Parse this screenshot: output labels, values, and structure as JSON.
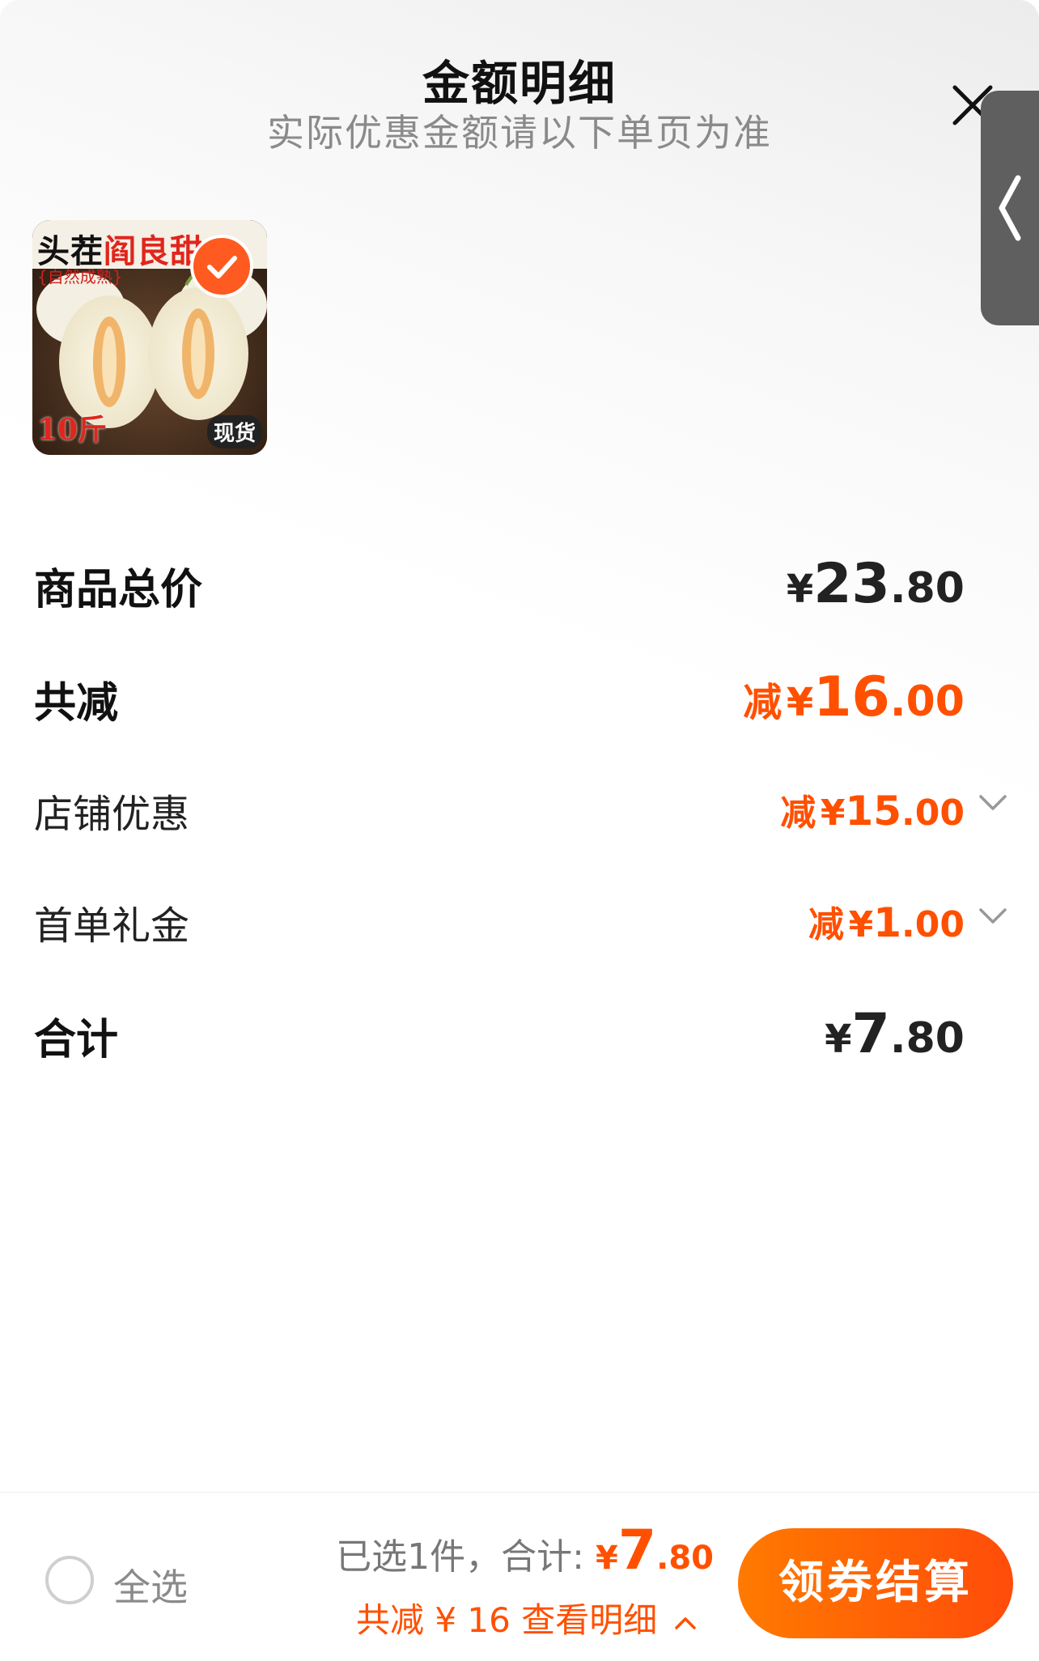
{
  "header": {
    "title": "金额明细",
    "subtitle": "实际优惠金额请以下单页为准",
    "close_icon": "close-icon",
    "side_tab_icon": "chevron-left-icon"
  },
  "product": {
    "image_top_text_a": "头茬",
    "image_top_text_b": "阎良甜",
    "image_sub_text": "{自然成熟}",
    "image_weight": "10斤",
    "image_badge": "现货",
    "selected": true
  },
  "rows": {
    "total": {
      "label": "商品总价",
      "currency": "¥",
      "integer": "23",
      "decimal": ".80"
    },
    "discount": {
      "label": "共减",
      "prefix": "减",
      "currency": "¥",
      "integer": "16",
      "decimal": ".00"
    },
    "shop": {
      "label": "店铺优惠",
      "prefix": "减",
      "currency": "¥",
      "integer": "15",
      "decimal": ".00"
    },
    "first_order": {
      "label": "首单礼金",
      "prefix": "减",
      "currency": "¥",
      "integer": "1",
      "decimal": ".00"
    },
    "sum": {
      "label": "合计",
      "currency": "¥",
      "integer": "7",
      "decimal": ".80"
    }
  },
  "bottom": {
    "select_all": "全选",
    "selected_text": "已选1件，合计:",
    "currency": "¥",
    "price_integer": "7",
    "price_decimal": ".80",
    "savings_text": "共减 ¥ 16  查看明细",
    "checkout_label": "领券结算"
  },
  "colors": {
    "accent": "#ff5000",
    "button_start": "#ff7a00",
    "button_end": "#ff4c0a"
  }
}
